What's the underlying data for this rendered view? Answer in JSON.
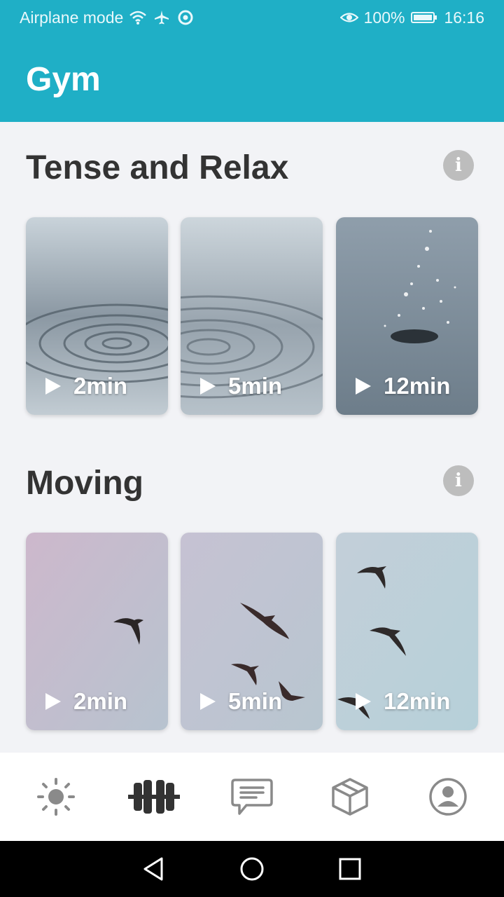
{
  "status_bar": {
    "left_text": "Airplane mode",
    "battery": "100%",
    "time": "16:16",
    "icons": [
      "wifi-icon",
      "airplane-icon",
      "chrome-icon",
      "eye-icon",
      "battery-icon"
    ]
  },
  "app_bar": {
    "title": "Gym",
    "color": "#1fafc6"
  },
  "sections": [
    {
      "title": "Tense and Relax",
      "cards": [
        {
          "label": "2min",
          "image": "water-ripples"
        },
        {
          "label": "5min",
          "image": "water-ripples"
        },
        {
          "label": "12min",
          "image": "water-drop-splash"
        }
      ]
    },
    {
      "title": "Moving",
      "cards": [
        {
          "label": "2min",
          "image": "flying-bird"
        },
        {
          "label": "5min",
          "image": "flying-birds"
        },
        {
          "label": "12min",
          "image": "flying-birds"
        }
      ]
    }
  ],
  "bottom_nav": {
    "items": [
      "sun-icon",
      "dumbbell-icon",
      "chat-icon",
      "box-icon",
      "profile-icon"
    ],
    "active": "dumbbell-icon"
  },
  "system_nav": [
    "back-icon",
    "home-icon",
    "recents-icon"
  ]
}
